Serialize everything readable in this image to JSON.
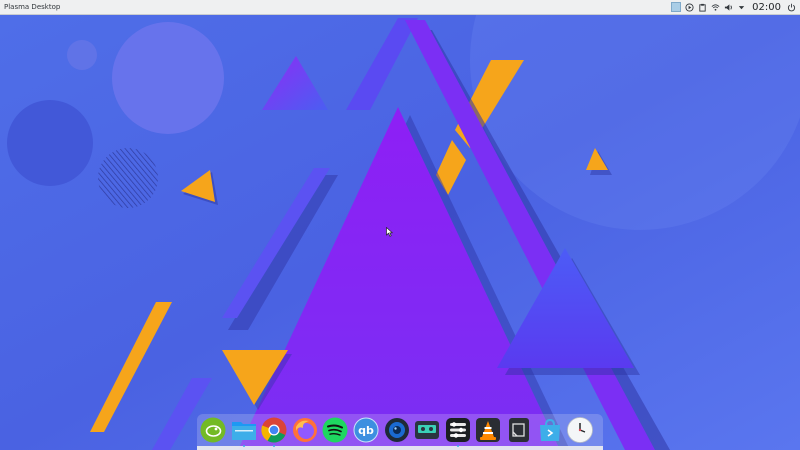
{
  "panel": {
    "title": "Plasma Desktop",
    "clock": "02:00",
    "tray_icons": [
      "virtual-desktop-pager-icon",
      "media-player-icon",
      "clipboard-icon",
      "network-wifi-icon",
      "volume-icon",
      "expand-tray-icon",
      "power-icon"
    ]
  },
  "desktop": {
    "wallpaper_colors": {
      "background": "#4a64e0",
      "purple": "#8f1cf5",
      "violet": "#6a3cf2",
      "blue": "#4b5ef3",
      "orange": "#f6a51b",
      "shadow": "#2b2f8f"
    }
  },
  "dock": {
    "items": [
      {
        "name": "opensuse-icon",
        "running": false
      },
      {
        "name": "file-manager-icon",
        "running": true
      },
      {
        "name": "chrome-icon",
        "running": true
      },
      {
        "name": "firefox-icon",
        "running": false
      },
      {
        "name": "spotify-icon",
        "running": false
      },
      {
        "name": "qbittorrent-icon",
        "running": false
      },
      {
        "name": "webcam-icon",
        "running": false
      },
      {
        "name": "media-icon",
        "running": false
      },
      {
        "name": "mixer-icon",
        "running": true
      },
      {
        "name": "vlc-icon",
        "running": false
      },
      {
        "name": "notes-icon",
        "running": false
      },
      {
        "name": "discover-store-icon",
        "running": false
      },
      {
        "name": "clock-icon",
        "running": false
      }
    ]
  }
}
